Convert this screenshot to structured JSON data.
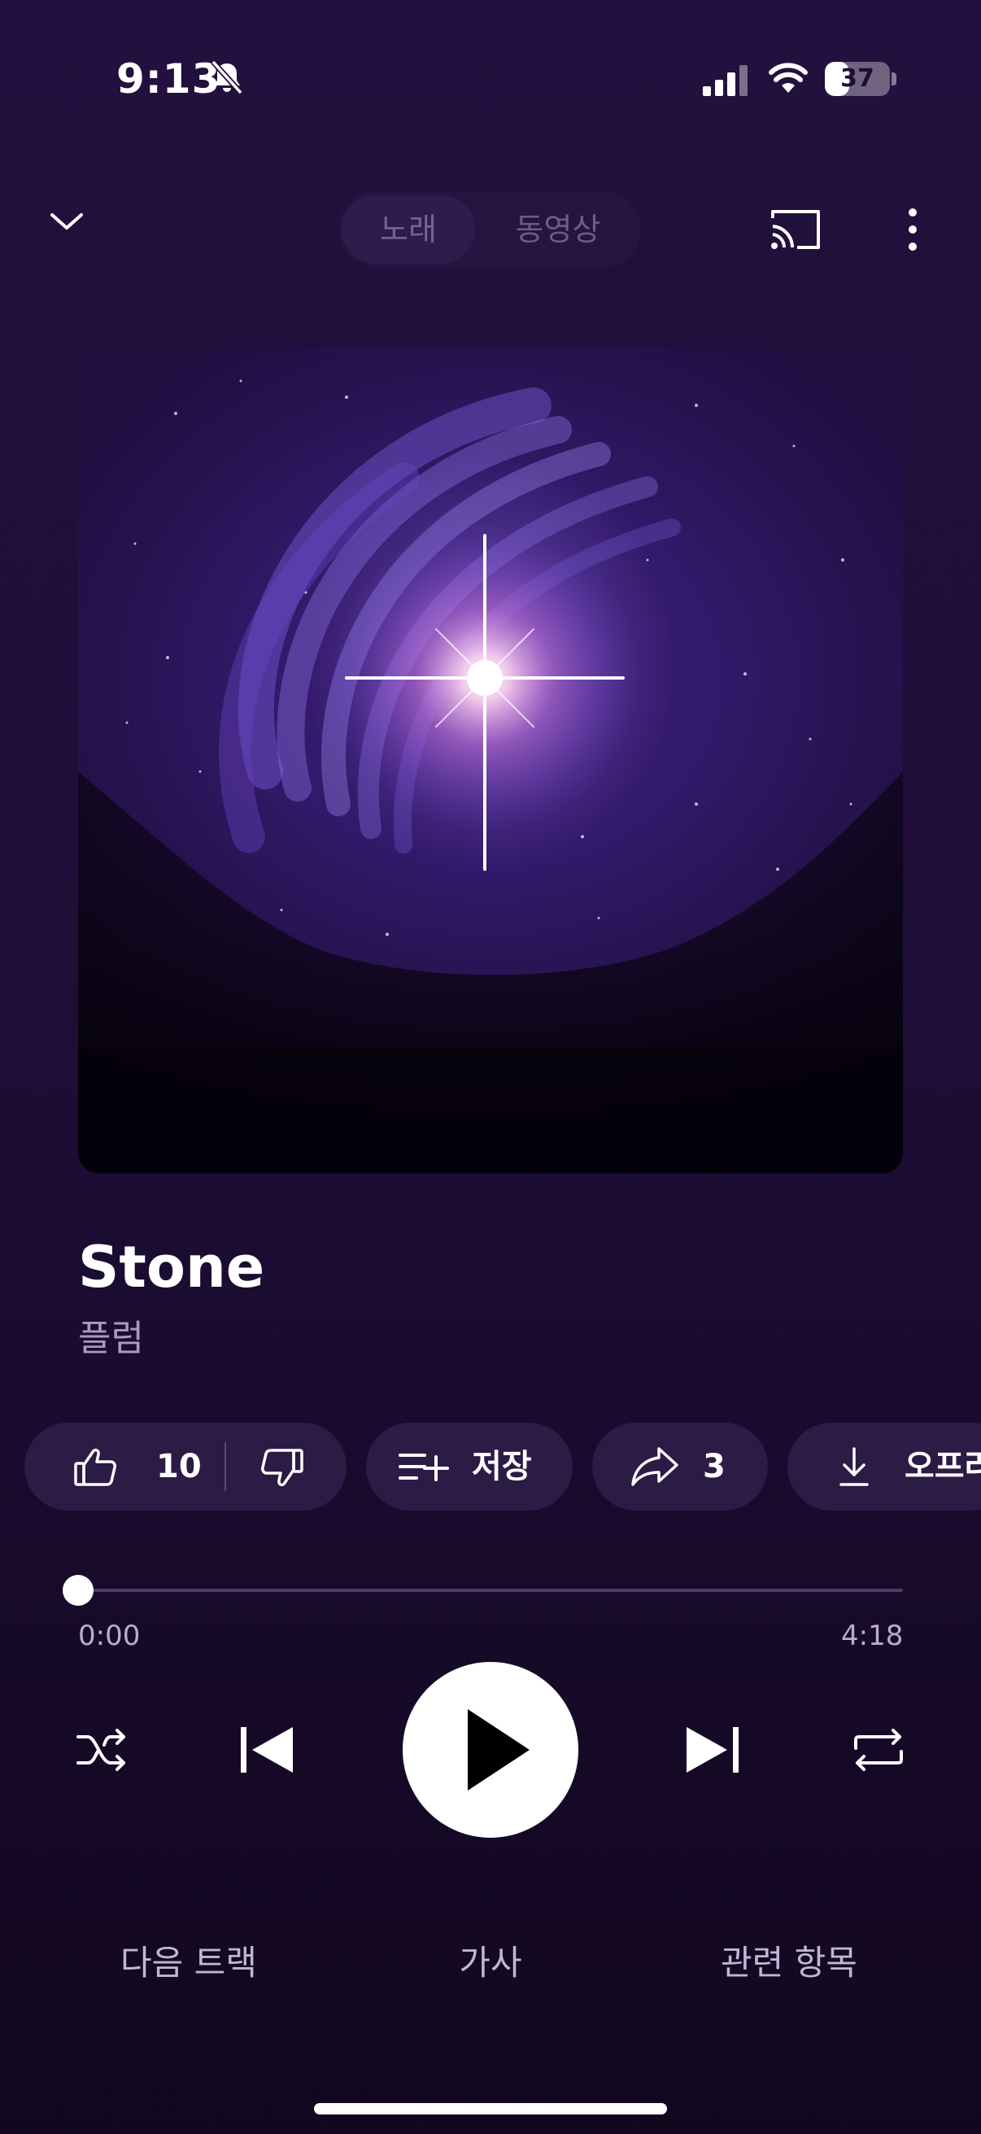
{
  "status_bar": {
    "time": "9:13",
    "battery_level": "37",
    "battery_fraction": 0.37,
    "icons": [
      "silent-bell-icon",
      "cellular-signal-icon",
      "wifi-icon",
      "battery-icon"
    ]
  },
  "header": {
    "tabs": [
      {
        "label": "노래",
        "active": true
      },
      {
        "label": "동영상",
        "active": false
      }
    ],
    "icons": [
      "chevron-down-icon",
      "cast-icon",
      "more-vert-icon"
    ]
  },
  "track": {
    "title": "Stone",
    "artist": "플럼"
  },
  "actions": {
    "like_count": "10",
    "save_label": "저장",
    "share_count": "3",
    "offline_label": "오프라"
  },
  "progress": {
    "current": "0:00",
    "total": "4:18",
    "fraction": 0.0
  },
  "bottom_tabs": [
    "다음 트랙",
    "가사",
    "관련 항목"
  ],
  "colors": {
    "background": "#1f0e38",
    "chip": "#2c1b45",
    "accent": "#ffffff"
  }
}
